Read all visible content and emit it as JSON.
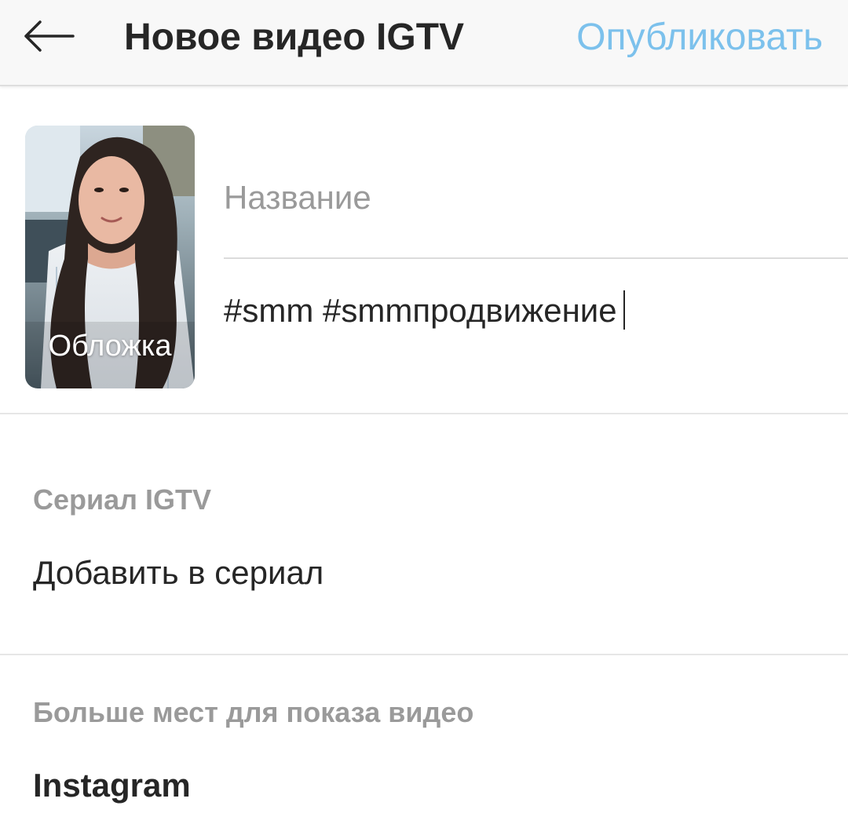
{
  "header": {
    "title": "Новое видео IGTV",
    "publish_label": "Опубликовать",
    "back_icon": "arrow-left-icon"
  },
  "cover": {
    "label": "Обложка"
  },
  "form": {
    "title_placeholder": "Название",
    "description_value": "#smm #smmпродвижение"
  },
  "series": {
    "section_label": "Сериал IGTV",
    "add_label": "Добавить в сериал"
  },
  "more_places": {
    "section_label": "Больше мест для показа видео",
    "instagram_label": "Instagram"
  },
  "colors": {
    "accent": "#7cc1ec",
    "text": "#262626",
    "muted": "#9a9a9a",
    "divider": "#e6e6e6",
    "topbar_bg": "#f8f8f8"
  }
}
